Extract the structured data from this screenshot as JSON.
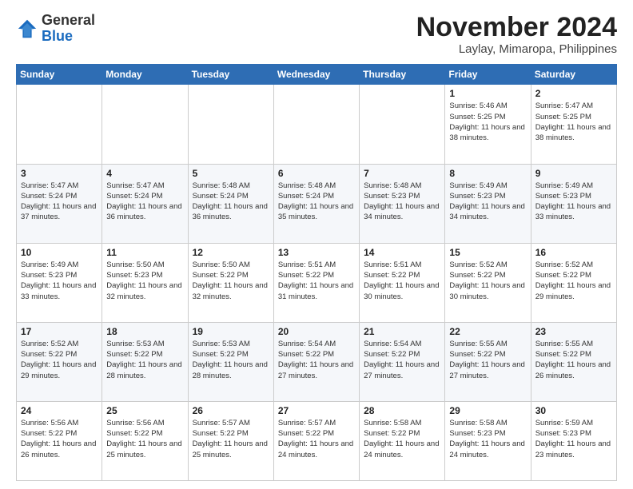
{
  "logo": {
    "general": "General",
    "blue": "Blue"
  },
  "header": {
    "month": "November 2024",
    "location": "Laylay, Mimaropa, Philippines"
  },
  "weekdays": [
    "Sunday",
    "Monday",
    "Tuesday",
    "Wednesday",
    "Thursday",
    "Friday",
    "Saturday"
  ],
  "weeks": [
    [
      {
        "day": "",
        "info": ""
      },
      {
        "day": "",
        "info": ""
      },
      {
        "day": "",
        "info": ""
      },
      {
        "day": "",
        "info": ""
      },
      {
        "day": "",
        "info": ""
      },
      {
        "day": "1",
        "info": "Sunrise: 5:46 AM\nSunset: 5:25 PM\nDaylight: 11 hours\nand 38 minutes."
      },
      {
        "day": "2",
        "info": "Sunrise: 5:47 AM\nSunset: 5:25 PM\nDaylight: 11 hours\nand 38 minutes."
      }
    ],
    [
      {
        "day": "3",
        "info": "Sunrise: 5:47 AM\nSunset: 5:24 PM\nDaylight: 11 hours\nand 37 minutes."
      },
      {
        "day": "4",
        "info": "Sunrise: 5:47 AM\nSunset: 5:24 PM\nDaylight: 11 hours\nand 36 minutes."
      },
      {
        "day": "5",
        "info": "Sunrise: 5:48 AM\nSunset: 5:24 PM\nDaylight: 11 hours\nand 36 minutes."
      },
      {
        "day": "6",
        "info": "Sunrise: 5:48 AM\nSunset: 5:24 PM\nDaylight: 11 hours\nand 35 minutes."
      },
      {
        "day": "7",
        "info": "Sunrise: 5:48 AM\nSunset: 5:23 PM\nDaylight: 11 hours\nand 34 minutes."
      },
      {
        "day": "8",
        "info": "Sunrise: 5:49 AM\nSunset: 5:23 PM\nDaylight: 11 hours\nand 34 minutes."
      },
      {
        "day": "9",
        "info": "Sunrise: 5:49 AM\nSunset: 5:23 PM\nDaylight: 11 hours\nand 33 minutes."
      }
    ],
    [
      {
        "day": "10",
        "info": "Sunrise: 5:49 AM\nSunset: 5:23 PM\nDaylight: 11 hours\nand 33 minutes."
      },
      {
        "day": "11",
        "info": "Sunrise: 5:50 AM\nSunset: 5:23 PM\nDaylight: 11 hours\nand 32 minutes."
      },
      {
        "day": "12",
        "info": "Sunrise: 5:50 AM\nSunset: 5:22 PM\nDaylight: 11 hours\nand 32 minutes."
      },
      {
        "day": "13",
        "info": "Sunrise: 5:51 AM\nSunset: 5:22 PM\nDaylight: 11 hours\nand 31 minutes."
      },
      {
        "day": "14",
        "info": "Sunrise: 5:51 AM\nSunset: 5:22 PM\nDaylight: 11 hours\nand 30 minutes."
      },
      {
        "day": "15",
        "info": "Sunrise: 5:52 AM\nSunset: 5:22 PM\nDaylight: 11 hours\nand 30 minutes."
      },
      {
        "day": "16",
        "info": "Sunrise: 5:52 AM\nSunset: 5:22 PM\nDaylight: 11 hours\nand 29 minutes."
      }
    ],
    [
      {
        "day": "17",
        "info": "Sunrise: 5:52 AM\nSunset: 5:22 PM\nDaylight: 11 hours\nand 29 minutes."
      },
      {
        "day": "18",
        "info": "Sunrise: 5:53 AM\nSunset: 5:22 PM\nDaylight: 11 hours\nand 28 minutes."
      },
      {
        "day": "19",
        "info": "Sunrise: 5:53 AM\nSunset: 5:22 PM\nDaylight: 11 hours\nand 28 minutes."
      },
      {
        "day": "20",
        "info": "Sunrise: 5:54 AM\nSunset: 5:22 PM\nDaylight: 11 hours\nand 27 minutes."
      },
      {
        "day": "21",
        "info": "Sunrise: 5:54 AM\nSunset: 5:22 PM\nDaylight: 11 hours\nand 27 minutes."
      },
      {
        "day": "22",
        "info": "Sunrise: 5:55 AM\nSunset: 5:22 PM\nDaylight: 11 hours\nand 27 minutes."
      },
      {
        "day": "23",
        "info": "Sunrise: 5:55 AM\nSunset: 5:22 PM\nDaylight: 11 hours\nand 26 minutes."
      }
    ],
    [
      {
        "day": "24",
        "info": "Sunrise: 5:56 AM\nSunset: 5:22 PM\nDaylight: 11 hours\nand 26 minutes."
      },
      {
        "day": "25",
        "info": "Sunrise: 5:56 AM\nSunset: 5:22 PM\nDaylight: 11 hours\nand 25 minutes."
      },
      {
        "day": "26",
        "info": "Sunrise: 5:57 AM\nSunset: 5:22 PM\nDaylight: 11 hours\nand 25 minutes."
      },
      {
        "day": "27",
        "info": "Sunrise: 5:57 AM\nSunset: 5:22 PM\nDaylight: 11 hours\nand 24 minutes."
      },
      {
        "day": "28",
        "info": "Sunrise: 5:58 AM\nSunset: 5:22 PM\nDaylight: 11 hours\nand 24 minutes."
      },
      {
        "day": "29",
        "info": "Sunrise: 5:58 AM\nSunset: 5:23 PM\nDaylight: 11 hours\nand 24 minutes."
      },
      {
        "day": "30",
        "info": "Sunrise: 5:59 AM\nSunset: 5:23 PM\nDaylight: 11 hours\nand 23 minutes."
      }
    ]
  ]
}
